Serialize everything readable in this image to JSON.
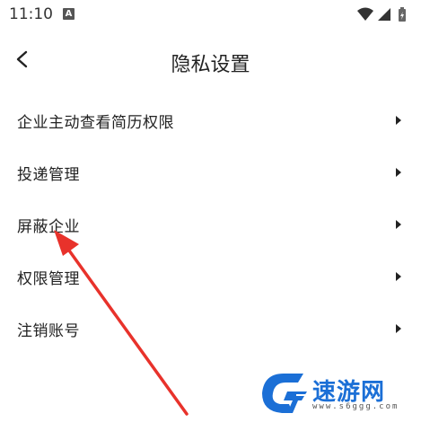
{
  "status_bar": {
    "time": "11:10",
    "notification_badge": "A",
    "icons": [
      "wifi-icon",
      "signal-icon",
      "battery-icon"
    ]
  },
  "header": {
    "back_icon": "chevron-left-icon",
    "title": "隐私设置"
  },
  "menu": {
    "items": [
      {
        "label": "企业主动查看简历权限"
      },
      {
        "label": "投递管理"
      },
      {
        "label": "屏蔽企业"
      },
      {
        "label": "权限管理"
      },
      {
        "label": "注销账号"
      }
    ],
    "chevron_icon": "chevron-right-icon"
  },
  "annotation": {
    "type": "red-arrow",
    "color": "#e8322b",
    "points_to": "屏蔽企业"
  },
  "watermark": {
    "text": "速游网",
    "url": "www.s6ggg.com",
    "color": "#1b6fd6"
  }
}
